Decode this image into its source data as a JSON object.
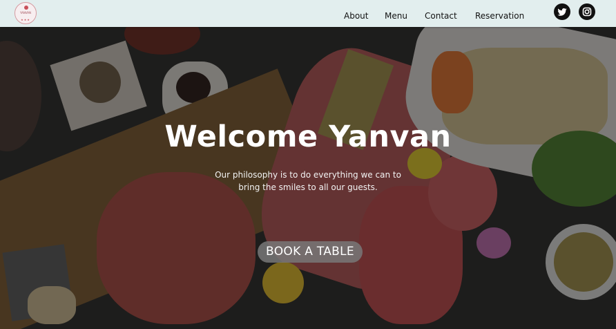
{
  "brand": {
    "logo_text": "YANVAN",
    "logo_stars": "★★★"
  },
  "nav": {
    "links": [
      "About",
      "Menu",
      "Contact",
      "Reservation"
    ]
  },
  "social": {
    "icons": [
      "twitter-icon",
      "instagram-icon"
    ]
  },
  "hero": {
    "title": "Welcome Yanvan",
    "subtitle_line1": "Our philosophy is to do everything we can to",
    "subtitle_line2": "bring the smiles to all our guests.",
    "cta_label": "BOOK A TABLE"
  },
  "colors": {
    "nav_bg": "#e2eeee",
    "hero_overlay": "#0a0a0a",
    "button_bg": "#787878"
  }
}
